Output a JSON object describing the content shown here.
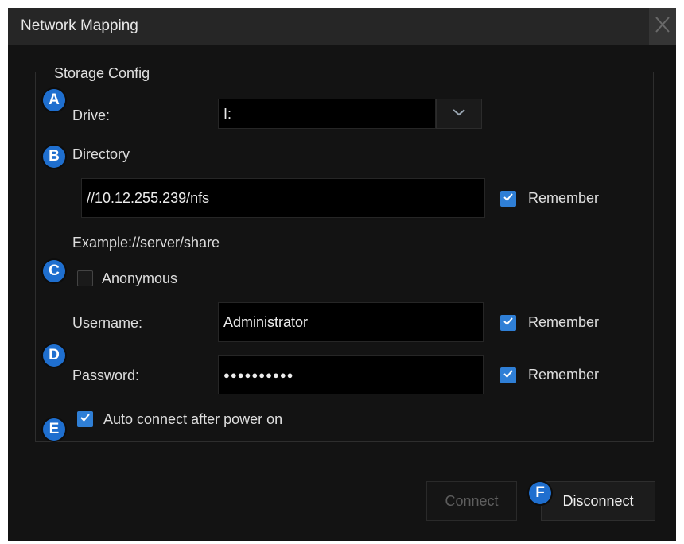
{
  "dialog": {
    "title": "Network Mapping"
  },
  "storage_config": {
    "title": "Storage Config",
    "drive": {
      "label": "Drive:",
      "value": "I:"
    },
    "directory": {
      "label": "Directory",
      "value": "//10.12.255.239/nfs",
      "remember_label": "Remember",
      "remember_checked": true,
      "example": "Example://server/share"
    },
    "anonymous": {
      "label": "Anonymous",
      "checked": false
    },
    "username": {
      "label": "Username:",
      "value": "Administrator",
      "remember_label": "Remember",
      "remember_checked": true
    },
    "password": {
      "label": "Password:",
      "value": "●●●●●●●●●●",
      "remember_label": "Remember",
      "remember_checked": true
    },
    "auto_connect": {
      "label": "Auto connect after power on",
      "checked": true
    }
  },
  "buttons": {
    "connect_label": "Connect",
    "disconnect_label": "Disconnect"
  },
  "badges": [
    "A",
    "B",
    "C",
    "D",
    "E",
    "F"
  ],
  "colors": {
    "accent": "#2f7fd6",
    "badge": "#1f6fcf",
    "background": "#131313",
    "titlebar": "#262626"
  },
  "icons": {
    "close": "close-icon",
    "dropdown": "chevron-down-icon",
    "check": "checkmark-icon"
  }
}
